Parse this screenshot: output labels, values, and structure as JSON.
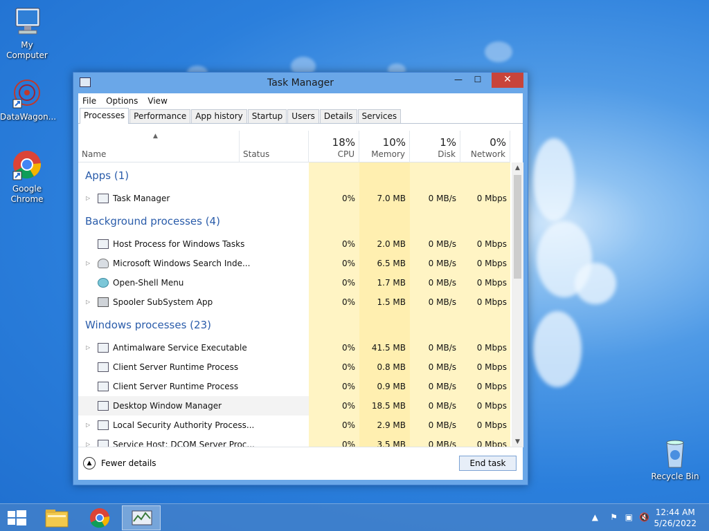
{
  "desktop": {
    "icons": [
      {
        "label": "My Computer"
      },
      {
        "label": "DataWagon..."
      },
      {
        "label": "Google Chrome"
      },
      {
        "label": "Recycle Bin"
      }
    ]
  },
  "window": {
    "title": "Task Manager",
    "controls": {
      "minimize": "—",
      "maximize": "☐",
      "close": "✕"
    },
    "menu": [
      "File",
      "Options",
      "View"
    ],
    "tabs": [
      "Processes",
      "Performance",
      "App history",
      "Startup",
      "Users",
      "Details",
      "Services"
    ],
    "active_tab": "Processes",
    "columns": {
      "name": "Name",
      "status": "Status",
      "cpu": {
        "pct": "18%",
        "label": "CPU"
      },
      "memory": {
        "pct": "10%",
        "label": "Memory"
      },
      "disk": {
        "pct": "1%",
        "label": "Disk"
      },
      "network": {
        "pct": "0%",
        "label": "Network"
      }
    },
    "groups": {
      "apps": "Apps (1)",
      "background": "Background processes (4)",
      "windows": "Windows processes (23)"
    },
    "rows": [
      {
        "name": "Task Manager",
        "cpu": "0%",
        "mem": "7.0 MB",
        "disk": "0 MB/s",
        "net": "0 Mbps"
      },
      {
        "name": "Host Process for Windows Tasks",
        "cpu": "0%",
        "mem": "2.0 MB",
        "disk": "0 MB/s",
        "net": "0 Mbps"
      },
      {
        "name": "Microsoft Windows Search Inde...",
        "cpu": "0%",
        "mem": "6.5 MB",
        "disk": "0 MB/s",
        "net": "0 Mbps"
      },
      {
        "name": "Open-Shell Menu",
        "cpu": "0%",
        "mem": "1.7 MB",
        "disk": "0 MB/s",
        "net": "0 Mbps"
      },
      {
        "name": "Spooler SubSystem App",
        "cpu": "0%",
        "mem": "1.5 MB",
        "disk": "0 MB/s",
        "net": "0 Mbps"
      },
      {
        "name": "Antimalware Service Executable",
        "cpu": "0%",
        "mem": "41.5 MB",
        "disk": "0 MB/s",
        "net": "0 Mbps"
      },
      {
        "name": "Client Server Runtime Process",
        "cpu": "0%",
        "mem": "0.8 MB",
        "disk": "0 MB/s",
        "net": "0 Mbps"
      },
      {
        "name": "Client Server Runtime Process",
        "cpu": "0%",
        "mem": "0.9 MB",
        "disk": "0 MB/s",
        "net": "0 Mbps"
      },
      {
        "name": "Desktop Window Manager",
        "cpu": "0%",
        "mem": "18.5 MB",
        "disk": "0 MB/s",
        "net": "0 Mbps"
      },
      {
        "name": "Local Security Authority Process...",
        "cpu": "0%",
        "mem": "2.9 MB",
        "disk": "0 MB/s",
        "net": "0 Mbps"
      },
      {
        "name": "Service Host: DCOM Server Proc...",
        "cpu": "0%",
        "mem": "3.5 MB",
        "disk": "0 MB/s",
        "net": "0 Mbps"
      }
    ],
    "footer": {
      "fewer_details": "Fewer details",
      "end_task": "End task"
    }
  },
  "taskbar": {
    "clock_time": "12:44 AM",
    "clock_date": "5/26/2022"
  }
}
